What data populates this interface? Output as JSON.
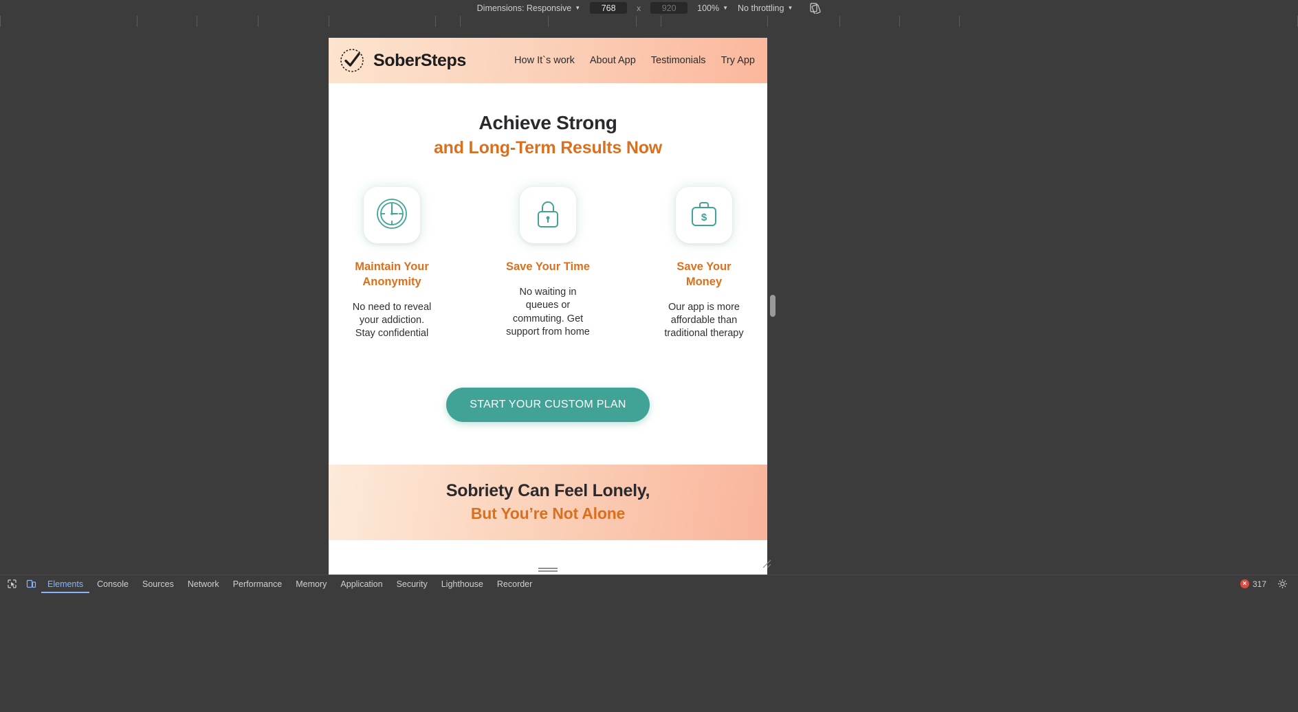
{
  "devtools": {
    "dimensions_label": "Dimensions: Responsive",
    "width_value": "768",
    "height_placeholder": "920",
    "separator": "x",
    "zoom_label": "100%",
    "throttling_label": "No throttling",
    "rotate_icon": "rotate-device-icon",
    "tabs": [
      {
        "label": "Elements",
        "active": true
      },
      {
        "label": "Console",
        "active": false
      },
      {
        "label": "Sources",
        "active": false
      },
      {
        "label": "Network",
        "active": false
      },
      {
        "label": "Performance",
        "active": false
      },
      {
        "label": "Memory",
        "active": false
      },
      {
        "label": "Application",
        "active": false
      },
      {
        "label": "Security",
        "active": false
      },
      {
        "label": "Lighthouse",
        "active": false
      },
      {
        "label": "Recorder",
        "active": false
      }
    ],
    "error_count": "317",
    "error_badge_glyph": "×",
    "settings_icon": "gear-icon",
    "inspect_icon": "inspect-element-icon",
    "device_toggle_icon": "device-toolbar-icon"
  },
  "site": {
    "brand": {
      "name": "SoberSteps",
      "logo_icon": "checkmark-dotted-circle-icon"
    },
    "nav": [
      {
        "label": "How It`s work"
      },
      {
        "label": "About App"
      },
      {
        "label": "Testimonials"
      },
      {
        "label": "Try App"
      }
    ],
    "hero": {
      "headline_dark": "Achieve Strong",
      "headline_accent": "and Long-Term Results Now"
    },
    "features": [
      {
        "icon": "clock-icon",
        "title": "Maintain Your Anonymity",
        "desc": "No need to reveal your addiction. Stay confidential"
      },
      {
        "icon": "lock-icon",
        "title": "Save Your Time",
        "desc": "No waiting in queues or commuting. Get support from home"
      },
      {
        "icon": "briefcase-dollar-icon",
        "title": "Save Your Money",
        "desc": "Our app is more affordable than traditional therapy"
      }
    ],
    "cta": {
      "label": "START YOUR CUSTOM PLAN"
    },
    "bottom_band": {
      "line_dark": "Sobriety Can Feel Lonely,",
      "line_accent": "But You’re Not Alone"
    },
    "colors": {
      "accent_orange": "#d9701f",
      "teal": "#40a395",
      "header_peach": "#fbb79c",
      "text_dark": "#2a2a2e"
    }
  }
}
